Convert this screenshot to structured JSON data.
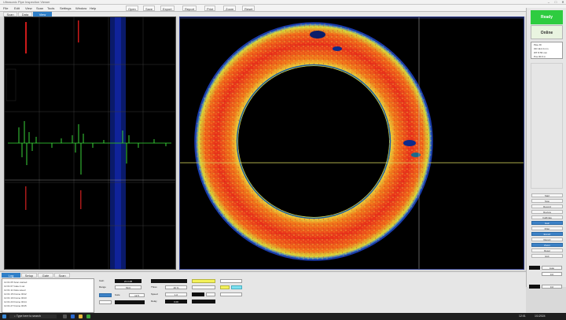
{
  "window": {
    "title": "Ultrasonic Pipe Inspection Viewer",
    "controls": [
      "–",
      "□",
      "✕"
    ]
  },
  "toolbar": {
    "items": [
      "File",
      "Edit",
      "View",
      "Scan",
      "Tools",
      "Settings",
      "Window",
      "Help"
    ],
    "buttons": [
      "Open",
      "Save",
      "Export",
      "Report",
      "Print",
      "Zoom",
      "Reset"
    ]
  },
  "tabs": {
    "items": [
      "Scan",
      "Data",
      "View"
    ],
    "active": 2
  },
  "side_panel": {
    "status_top": "Ready",
    "status_second": "Online",
    "info_lines": [
      "Pipe ID",
      "OD 114.3 mm",
      "WT 8.56 mm",
      "Pos 00.0 m"
    ],
    "buttons": [
      "Start",
      "Stop",
      "Record",
      "Review",
      "Calibrate",
      "Gain",
      "Filter",
      "Export",
      "Report",
      "Zoom",
      "Reset",
      "Exit"
    ],
    "blue_buttons": [
      5,
      7,
      9
    ]
  },
  "bottom_panel": {
    "tabs": [
      "Log",
      "Setup",
      "Gate",
      "Scan"
    ],
    "active_tab": 0,
    "log_rows": [
      "12:01:05  Scan started",
      "12:01:07  Gate A set",
      "12:01:11  Data saved",
      "12:01:15  Frame 0012",
      "12:01:19  Frame 0013",
      "12:01:23  Frame 0014",
      "12:01:27  Frame 0015"
    ],
    "controls": {
      "gain_label": "Gain",
      "gain_value": "24.0 dB",
      "range_label": "Range",
      "range_value": "50.0",
      "gate_label": "Gate",
      "gate_value": "12.5",
      "thres_label": "Thres",
      "thres_value": "40 %",
      "speed_label": "Speed",
      "speed_value": "1.0",
      "delay_label": "Delay",
      "delay_value": "0.00"
    },
    "right_cluster": {
      "mode": "Auto",
      "value_a": "0.0",
      "value_b": "0.0"
    }
  },
  "taskbar": {
    "search": "Type here to search",
    "time": "12:01",
    "date": "1/1/2024"
  },
  "icons": {
    "window_close": "close-icon",
    "search": "search-icon",
    "start": "windows-icon"
  },
  "colors": {
    "status_green": "#2ecc40",
    "accent_blue": "#2f7fc8",
    "crosshair": "#e0e060"
  }
}
